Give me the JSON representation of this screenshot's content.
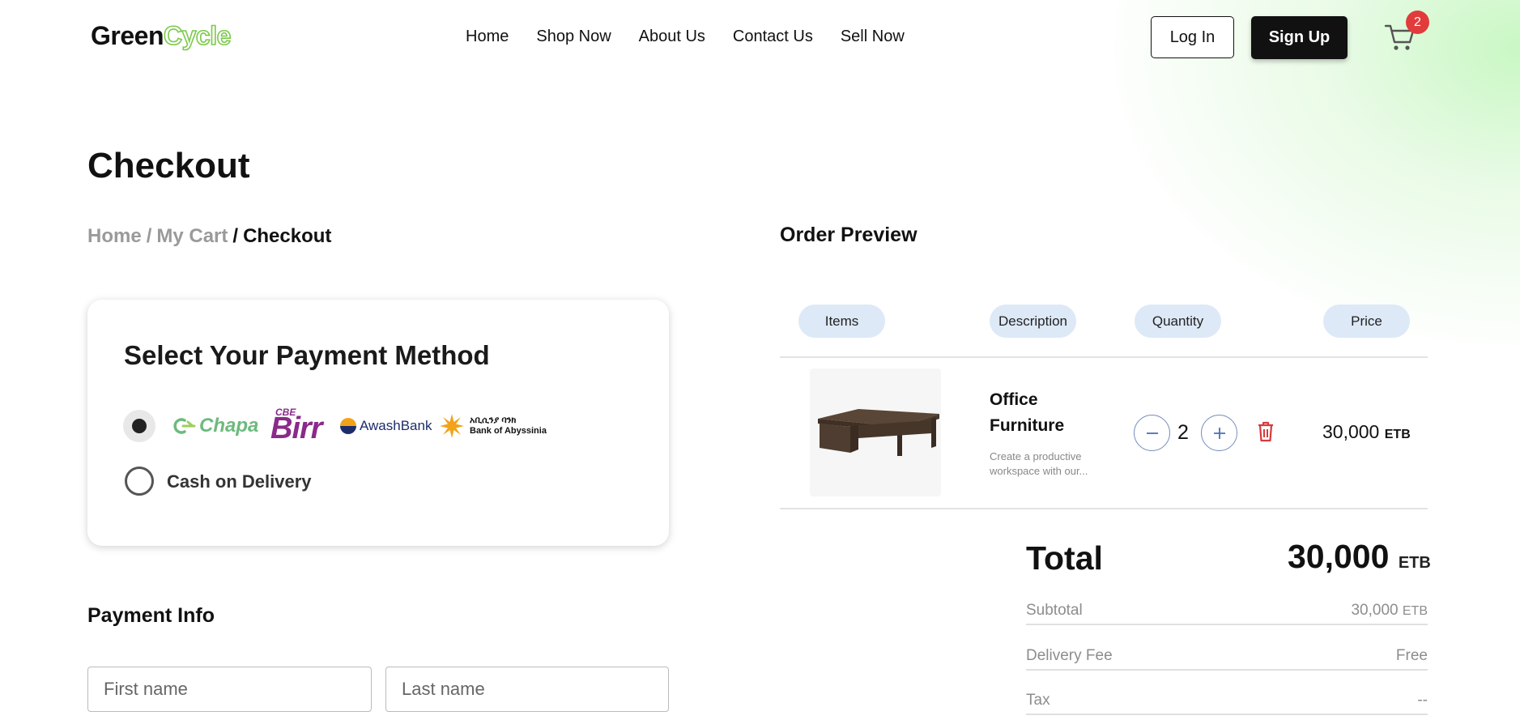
{
  "header": {
    "logo_green": "Green",
    "logo_cycle": "Cycle",
    "nav": [
      "Home",
      "Shop Now",
      "About Us",
      "Contact Us",
      "Sell Now"
    ],
    "login_label": "Log In",
    "signup_label": "Sign Up",
    "cart_count": "2"
  },
  "page": {
    "title": "Checkout",
    "breadcrumb": {
      "home": "Home",
      "sep1": "/",
      "cart": "My Cart",
      "sep2": "/",
      "current": "Checkout"
    }
  },
  "payment": {
    "title": "Select Your Payment Method",
    "options": [
      {
        "id": "online",
        "selected": true,
        "providers": [
          "Chapa",
          "CBE Birr",
          "AwashBank",
          "Bank of Abyssinia"
        ]
      },
      {
        "id": "cod",
        "selected": false,
        "label": "Cash on Delivery"
      }
    ],
    "providers": {
      "chapa": "Chapa",
      "cbe": "CBE",
      "birr": "Birr",
      "awash": "AwashBank",
      "boa_amharic": "አቢሲንያ ባንክ",
      "boa": "Bank of Abyssinia"
    }
  },
  "payment_info": {
    "title": "Payment Info",
    "first_name_placeholder": "First name",
    "last_name_placeholder": "Last name"
  },
  "order": {
    "title": "Order Preview",
    "columns": [
      "Items",
      "Description",
      "Quantity",
      "Price"
    ],
    "items": [
      {
        "name": "Office Furniture",
        "description": "Create a productive workspace with our...",
        "quantity": "2",
        "price": "30,000",
        "currency": "ETB"
      }
    ],
    "total_label": "Total",
    "total_value": "30,000",
    "currency": "ETB",
    "summary": {
      "subtotal_label": "Subtotal",
      "subtotal_value": "30,000",
      "delivery_label": "Delivery Fee",
      "delivery_value": "Free",
      "tax_label": "Tax",
      "tax_value": "--"
    }
  },
  "colors": {
    "brand_green": "#7bc94a",
    "accent_pill": "#dde9f7",
    "badge_red": "#e23b3b",
    "trash_red": "#d63b3b"
  }
}
